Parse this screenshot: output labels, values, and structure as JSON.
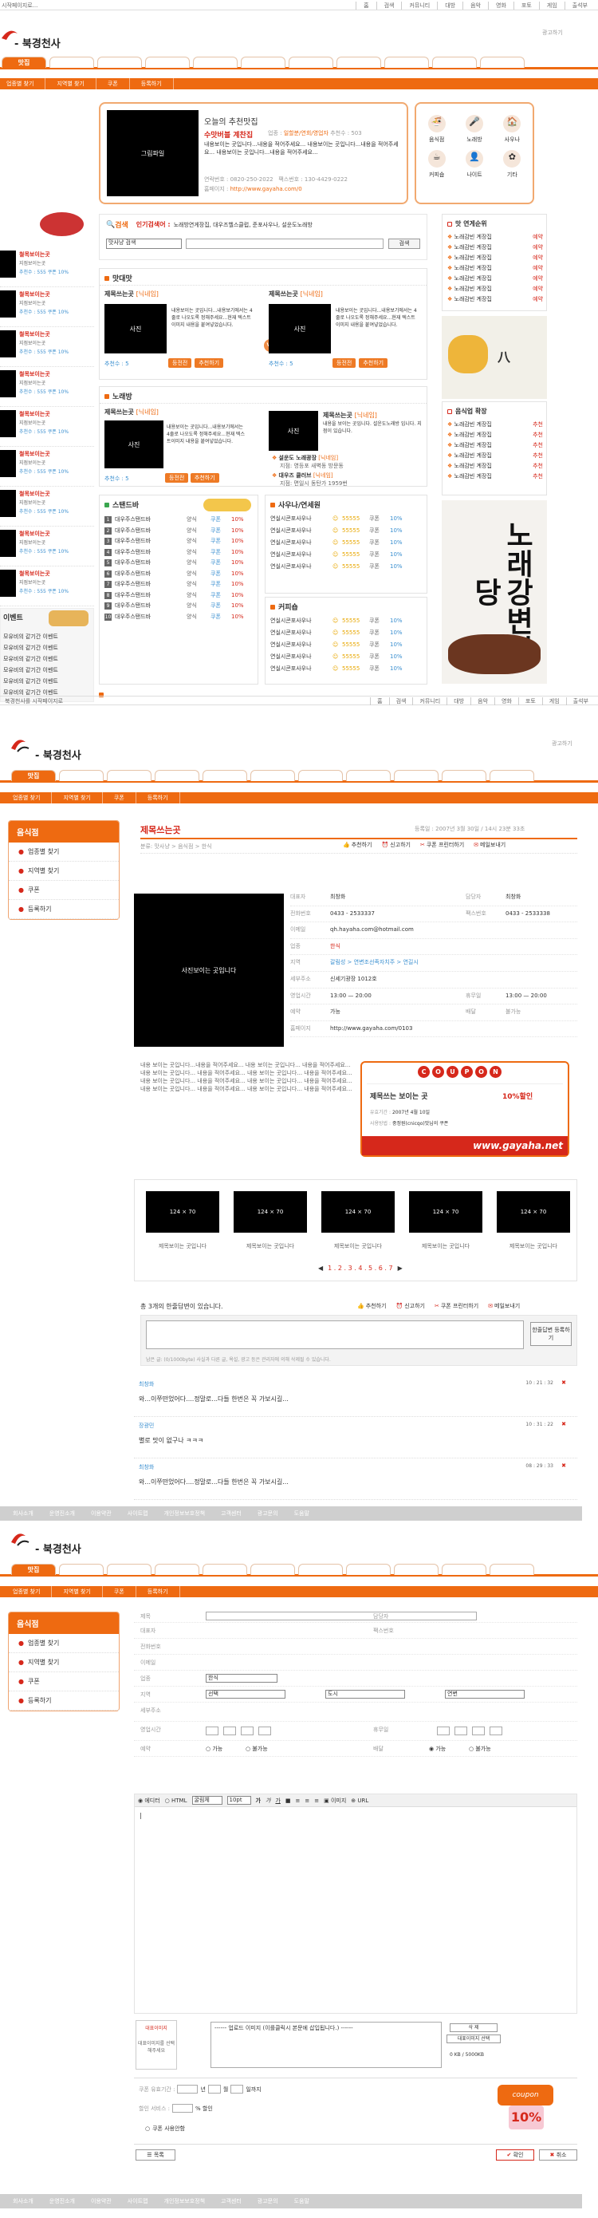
{
  "topnav": {
    "left": "시작페이지로...",
    "links": [
      "홈",
      "검색",
      "커뮤니티",
      "대방",
      "음악",
      "영화",
      "포토",
      "게임",
      "출석부"
    ]
  },
  "site": {
    "name": "- 북경천사",
    "ad_label": "광고하기"
  },
  "nav": {
    "tab_active": "맛집",
    "sub": [
      "업종별 찾기",
      "지역별 찾기",
      "쿠폰",
      "등록하기"
    ]
  },
  "section1": {
    "photo_label": "그림파일",
    "today_label": "오늘의 추천맛집",
    "restaurant_name": "수맛버블 계찬집",
    "category_label": "업종 :",
    "category_value": "일할분/연회/영업자",
    "recommend_label": "추천수 : 503",
    "desc": "내용보이는 곳입니다...내용을 적어주세요... 내용보이는 곳입니다...내용을 적어주세요... 내용보이는 곳입니다...내용을 적어주세요...",
    "phone_label": "연락번호",
    "phone": "0820-250-2022",
    "fax_label": "팩스번호",
    "fax": "130-4429-0222",
    "homepage_label": "홈페이지",
    "homepage": "http://www.gayaha.com/0",
    "icons": [
      {
        "icon": "noodle-icon",
        "label": "음식점"
      },
      {
        "icon": "mic-icon",
        "label": "노래방"
      },
      {
        "icon": "house-icon",
        "label": "사우나"
      },
      {
        "icon": "coffee-icon",
        "label": "커피숍"
      },
      {
        "icon": "person-icon",
        "label": "나이트"
      },
      {
        "icon": "flower-icon",
        "label": "기타"
      }
    ]
  },
  "search": {
    "label": "검색",
    "hot_label": "인기검색어 :",
    "hot": "노래방연게장집, 대우즈헬스클럽, 준포사우나, 설운도노래방",
    "select": "맛사냥 검색",
    "button": "검색"
  },
  "left_strip": {
    "items": [
      {
        "title": "철목보이는곳",
        "sub": "지점보이는곳",
        "meta": "추천수 : 555 쿠폰 10%"
      },
      {
        "title": "철목보이는곳",
        "sub": "지점보이는곳",
        "meta": "추천수 : 555 쿠폰 10%"
      },
      {
        "title": "철목보이는곳",
        "sub": "지점보이는곳",
        "meta": "추천수 : 555 쿠폰 10%"
      },
      {
        "title": "철목보이는곳",
        "sub": "지점보이는곳",
        "meta": "추천수 : 555 쿠폰 10%"
      },
      {
        "title": "철목보이는곳",
        "sub": "지점보이는곳",
        "meta": "추천수 : 555 쿠폰 10%"
      },
      {
        "title": "철목보이는곳",
        "sub": "지점보이는곳",
        "meta": "추천수 : 555 쿠폰 10%"
      },
      {
        "title": "철목보이는곳",
        "sub": "지점보이는곳",
        "meta": "추천수 : 555 쿠폰 10%"
      },
      {
        "title": "철목보이는곳",
        "sub": "지점보이는곳",
        "meta": "추천수 : 555 쿠폰 10%"
      },
      {
        "title": "철목보이는곳",
        "sub": "지점보이는곳",
        "meta": "추천수 : 555 쿠폰 10%"
      }
    ],
    "event_title": "이벤트",
    "events": [
      "모유비의 같기간 이벤트",
      "모유비의 같기간 이벤트",
      "모유비의 같기간 이벤트",
      "모유비의 같기간 이벤트",
      "모유비의 같기간 이벤트",
      "모유비의 같기간 이벤트"
    ]
  },
  "ranking": {
    "title": "맛 연게순위",
    "items": [
      "노래감빈 계장집",
      "노래감빈 계장집",
      "노래감빈 계장집",
      "노래감빈 계장집",
      "노래감빈 계장집",
      "노래감빈 계장집",
      "노래감빈 계장집"
    ],
    "tag": "예약"
  },
  "ranking2": {
    "title": "음식업 확장",
    "items": [
      "노래감빈 계장집",
      "노래감빈 계장집",
      "노래감빈 계장집",
      "노래감빈 계장집",
      "노래감빈 계장집",
      "노래감빈 계장집"
    ],
    "tag": "추천"
  },
  "food": {
    "title": "맛대맛",
    "cards": [
      {
        "name": "제목쓰는곳",
        "sub": "[닉네임]",
        "photo": "사진",
        "desc": "내용보이는 곳입니다...내용보기에서는 4줄로 나오도록 정해주세요...현재 텍스트이미지 내용을 붙여넣었습니다.",
        "count": "추천수 : 5",
        "btn1": "등전전",
        "btn2": "추천하기"
      },
      {
        "name": "제목쓰는곳",
        "sub": "[닉네임]",
        "photo": "사진",
        "desc": "내용보이는 곳입니다...내용보기에서는 4줄로 나오도록 정해주세요...현재 텍스트이미지 내용을 붙여넣었습니다.",
        "count": "추천수 : 5",
        "btn1": "등전전",
        "btn2": "추천하기"
      }
    ],
    "vs": "VS"
  },
  "karaoke": {
    "title": "노래방",
    "card": {
      "name": "제목쓰는곳",
      "sub": "[닉네임]",
      "photo": "사진",
      "desc": "내용보이는 곳입니다...내용보기에서는 4줄로 나오도록 정해주세요...현재 텍스트이미지 내용을 붙여넣었습니다.",
      "count": "추천수 : 5",
      "btn1": "등전전",
      "btn2": "추천하기"
    },
    "right": {
      "photo": "사진",
      "name": "제목쓰는곳",
      "sub": "[닉네임]",
      "desc": "내용을 보이는 곳입니다. 설운도노래방 입니다. 지점이 있습니다.",
      "items": [
        {
          "name": "설운도 노래광장",
          "sub": "[닉네임]",
          "addr": "지점: 영등포 새벽동 방문동"
        },
        {
          "name": "대우즈 클러브",
          "sub": "[닉네임]",
          "addr": "지점: 면일시 동탄가 1959번"
        }
      ]
    }
  },
  "stand": {
    "title": "스탠드바",
    "rows": [
      "대우주스탠드바",
      "대우주스탠드바",
      "대우주스탠드바",
      "대우주스탠드바",
      "대우주스탠드바",
      "대우주스탠드바",
      "대우주스탠드바",
      "대우주스탠드바",
      "대우주스탠드바",
      "대우주스탠드바"
    ],
    "c1": "양식",
    "c2": "쿠폰",
    "c3": "10%"
  },
  "sauna": {
    "title": "사우나/연세원",
    "rows": [
      "연실시콘포사우나",
      "연실시콘포사우나",
      "연실시콘포사우나",
      "연실시콘포사우나",
      "연실시콘포사우나"
    ],
    "num": "55555",
    "c2": "쿠폰",
    "c3": "10%"
  },
  "cafe": {
    "title": "커피숍",
    "rows": [
      "연실시콘포사우나",
      "연실시콘포사우나",
      "연실시콘포사우나",
      "연실시콘포사우나",
      "연실시콘포사우나"
    ],
    "num": "55555",
    "c2": "쿠폰",
    "c3": "10%"
  },
  "page1_footer_left": "북경천사를 시작페이지로",
  "page1_footer_links": [
    "홈",
    "검색",
    "커뮤니티",
    "대방",
    "음악",
    "영화",
    "포토",
    "게임",
    "출석부"
  ],
  "banner_big": "노래강변식당",
  "detail": {
    "menu_title": "음식점",
    "menu": [
      "업종별 찾기",
      "지역별 찾기",
      "쿠폰",
      "등록하기"
    ],
    "title": "제목쓰는곳",
    "date": "등록일 : 2007년 3월 30일 / 14시 23분 33초",
    "crumb": "분류: 맛사냥 > 음식점 > 한식",
    "counts": "조회수 : 2360 │ 금고 : 50000",
    "actions": [
      "추천하기",
      "신고하기",
      "쿠폰 프린터하기",
      "메일보내기"
    ],
    "photo": "사진보이는 곳입니다",
    "fields": [
      {
        "l": "대표자",
        "v": "최창화",
        "l2": "담당자",
        "v2": "최창화"
      },
      {
        "l": "전화번호",
        "v": "0433 - 2533337",
        "l2": "팩스번호",
        "v2": "0433 - 2533338"
      },
      {
        "l": "이메일",
        "v": "qh.hayaha.com@hotmail.com",
        "l2": "",
        "v2": ""
      },
      {
        "l": "업종",
        "v": "한식",
        "l2": "",
        "v2": ""
      },
      {
        "l": "지역",
        "v": "갈림성 > 연변조선족자치주 > 연길시",
        "l2": "",
        "v2": ""
      },
      {
        "l": "세부주소",
        "v": "신세기광장 1012호",
        "l2": "",
        "v2": ""
      },
      {
        "l": "영업시간",
        "v": "13:00 — 20:00",
        "l2": "휴무일",
        "v2": "13:00 — 20:00"
      },
      {
        "l": "예약",
        "v": "가능",
        "l2": "배달",
        "v2": "불가능"
      },
      {
        "l": "홈페이지",
        "v": "http://www.gayaha.com/0103",
        "l2": "",
        "v2": ""
      }
    ],
    "body": "내용 보이는 곳입니다...내용을 적어주세요... 내용 보이는 곳입니다... 내용을 적어주세요... 내용 보이는 곳입니다... 내용을 적어주세요... 내용 보이는 곳입니다... 내용을 적어주세요... 내용 보이는 곳입니다... 내용을 적어주세요... 내용 보이는 곳입니다... 내용을 적어주세요... 내용 보이는 곳입니다... 내용을 적어주세요... 내용 보이는 곳입니다... 내용을 적어주세요...",
    "coupon": {
      "letters": [
        "C",
        "O",
        "U",
        "P",
        "O",
        "N"
      ],
      "name": "제목쓰는 보이는 곳",
      "pct": "10%할인",
      "r1l": "유효기간 :",
      "r1": "2007년 4월 10일",
      "r2l": "사용방법 :",
      "r2": "중정원(cnicqo)맛님의 쿠폰",
      "site": "www.gayaha.net"
    },
    "thumbs": [
      {
        "size": "124 × 70",
        "cap": "제목보이는 곳입니다"
      },
      {
        "size": "124 × 70",
        "cap": "제목보이는 곳입니다"
      },
      {
        "size": "124 × 70",
        "cap": "제목보이는 곳입니다"
      },
      {
        "size": "124 × 70",
        "cap": "제목보이는 곳입니다"
      },
      {
        "size": "124 × 70",
        "cap": "제목보이는 곳입니다"
      }
    ],
    "pager": "1 . 2 . 3 . 4 . 5 . 6 . 7",
    "comment_count": "총 3개의 한줄답변이 있습니다.",
    "comment_btn": "한줄답변 등록하기",
    "comment_note": "남은 글: (0/1000byte) 사실과 다른 글, 욕설, 광고 등은 관리자에 의해 삭제될 수 있습니다.",
    "comments": [
      {
        "user": "최창화",
        "time": "10 : 21 : 32",
        "text": "와...이쭈떤었어다....정말로...다들 한번은 꼭 가보시길..."
      },
      {
        "user": "장광민",
        "time": "10 : 31 : 22",
        "text": "별로 맛이 없구나 ㅋㅋㅋ"
      },
      {
        "user": "최창화",
        "time": "08 : 29 : 33",
        "text": "와...이쭈떤었어다....정말로...다들 한번은 꼭 가보시길..."
      }
    ]
  },
  "footer_links": [
    "회사소개",
    "운영진소개",
    "이용약관",
    "사이트맵",
    "개인정보보호정책",
    "고객센터",
    "광고문의",
    "도움말"
  ],
  "form": {
    "labels": [
      "제목",
      "대표자",
      "전화번호",
      "이메일",
      "업종",
      "지역",
      "세부주소",
      "영업시간",
      "예약"
    ],
    "labels2": [
      "담당자",
      "팩스번호",
      "",
      "",
      "",
      "",
      "",
      "휴무일",
      "배달"
    ],
    "cat_select": "한식",
    "region": [
      "선택",
      "도시",
      "연변"
    ],
    "yes": "가능",
    "no": "불가능",
    "editor": {
      "tabs": [
        "에디터",
        "HTML"
      ],
      "font": "굴림체",
      "size": "10pt",
      "img": "이미지",
      "url": "URL",
      "cursor": "|"
    },
    "upload": {
      "label": "대표이미지",
      "desc": "대표이미지를 선택해주세요",
      "msg": "------ 업로드 이미지 (이를클릭시 본문에 삽입됩니다.) ------",
      "btn1": "삭 제",
      "btn2": "대표이미지 선택",
      "size": "0 KB / 5000KB"
    },
    "coupon": {
      "label1": "쿠폰 유효기간 :",
      "y": "년",
      "m": "월",
      "d": "일까지",
      "label2": "할인 서비스 :",
      "pct": "% 할인",
      "chk": "쿠폰 사용안함",
      "badge_t": "coupon",
      "badge_p": "10%"
    },
    "list_btn": "목록",
    "ok": "확인",
    "cancel": "취소"
  },
  "colors": {
    "accent": "#ee6a11",
    "red": "#d6281b"
  }
}
